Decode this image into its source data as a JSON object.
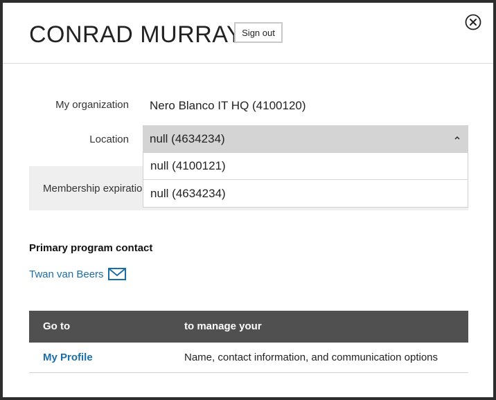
{
  "header": {
    "title": "CONRAD MURRAY",
    "sign_out_label": "Sign out"
  },
  "organization": {
    "label": "My organization",
    "value": "Nero Blanco IT HQ (4100120)"
  },
  "location": {
    "label": "Location",
    "selected": "null (4634234)",
    "options": [
      "null (4100121)",
      "null (4634234)"
    ]
  },
  "membership": {
    "label": "Membership expiration"
  },
  "contact": {
    "section_title": "Primary program contact",
    "name": "Twan van Beers"
  },
  "table": {
    "headers": [
      "Go to",
      "to manage your"
    ],
    "rows": [
      {
        "link": "My Profile",
        "description": "Name, contact information, and communication options"
      }
    ]
  },
  "colors": {
    "link": "#1a6ea8",
    "table_header_bg": "#505050",
    "select_bg": "#d4d4d4",
    "membership_bg": "#efefef"
  }
}
